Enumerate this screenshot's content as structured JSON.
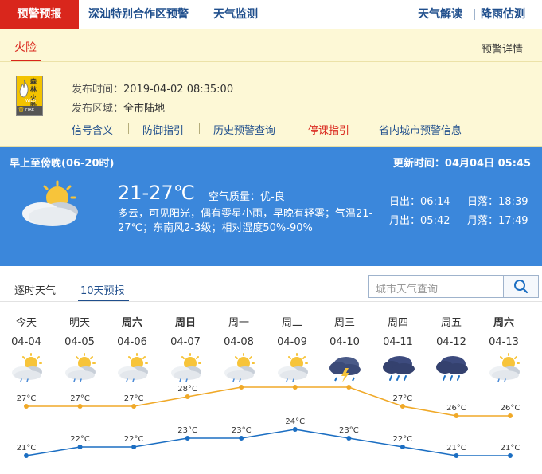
{
  "nav": {
    "active": "预警预报",
    "links": [
      "深汕特别合作区预警",
      "天气监测"
    ],
    "right_links": [
      "天气解读",
      "降雨估测"
    ]
  },
  "warning": {
    "tab": "火险",
    "detail_link": "预警详情",
    "icon": {
      "name": "forest-fire-yellow-icon",
      "text_top": "森林",
      "text_mid": "火险",
      "level": "黄",
      "label": "WILD FIRE"
    },
    "time_label": "发布时间：",
    "time_value": "2019-04-02 08:35:00",
    "area_label": "发布区域：",
    "area_value": "全市陆地",
    "links": [
      "信号含义",
      "防御指引",
      "历史预警查询",
      "停课指引",
      "省内城市预警信息"
    ]
  },
  "forecast": {
    "period": "早上至傍晚(06-20时)",
    "update_label": "更新时间：",
    "update_value": "04月04日 05:45",
    "temp": "21-27℃",
    "aq_label": "空气质量：",
    "aq_value": "优-良",
    "desc": "多云，可见阳光，偶有零星小雨，早晚有轻雾；气温21-27℃；东南风2-3级；相对湿度50%-90%",
    "sunrise_label": "日出：",
    "sunrise": "06:14",
    "sunset_label": "日落：",
    "sunset": "18:39",
    "moonrise_label": "月出：",
    "moonrise": "05:42",
    "moonset_label": "月落：",
    "moonset": "17:49"
  },
  "tabs": [
    "逐时天气",
    "10天预报"
  ],
  "search": {
    "placeholder": "城市天气查询"
  },
  "days": [
    {
      "name": "今天",
      "date": "04-04",
      "bold": false,
      "icon": "partly-cloudy-sun-rain-icon",
      "high": "27°C",
      "low": "21°C"
    },
    {
      "name": "明天",
      "date": "04-05",
      "bold": false,
      "icon": "partly-cloudy-sun-rain-icon",
      "high": "27°C",
      "low": "22°C"
    },
    {
      "name": "周六",
      "date": "04-06",
      "bold": true,
      "icon": "partly-cloudy-sun-rain-icon",
      "high": "27°C",
      "low": "22°C"
    },
    {
      "name": "周日",
      "date": "04-07",
      "bold": true,
      "icon": "partly-cloudy-sun-rain-icon",
      "high": "28°C",
      "low": "23°C"
    },
    {
      "name": "周一",
      "date": "04-08",
      "bold": false,
      "icon": "partly-cloudy-sun-rain-icon",
      "high": "29°C",
      "low": "23°C"
    },
    {
      "name": "周二",
      "date": "04-09",
      "bold": false,
      "icon": "partly-cloudy-sun-rain-icon",
      "high": "29°C",
      "low": "24°C"
    },
    {
      "name": "周三",
      "date": "04-10",
      "bold": false,
      "icon": "thunderstorm-icon",
      "high": "29°C",
      "low": "23°C"
    },
    {
      "name": "周四",
      "date": "04-11",
      "bold": false,
      "icon": "rain-cloud-icon",
      "high": "27°C",
      "low": "22°C"
    },
    {
      "name": "周五",
      "date": "04-12",
      "bold": false,
      "icon": "rain-cloud-icon",
      "high": "26°C",
      "low": "21°C"
    },
    {
      "name": "周六",
      "date": "04-13",
      "bold": true,
      "icon": "partly-cloudy-sun-rain-icon",
      "high": "26°C",
      "low": "21°C"
    }
  ],
  "chart_data": {
    "type": "line",
    "x": [
      "04-04",
      "04-05",
      "04-06",
      "04-07",
      "04-08",
      "04-09",
      "04-10",
      "04-11",
      "04-12",
      "04-13"
    ],
    "series": [
      {
        "values": [
          27,
          27,
          27,
          28,
          29,
          29,
          29,
          27,
          26,
          26
        ],
        "color": "#f0a928"
      },
      {
        "values": [
          21,
          22,
          22,
          23,
          23,
          24,
          23,
          22,
          21,
          21
        ],
        "color": "#1b6ec2"
      }
    ],
    "ylim": [
      20,
      30
    ]
  },
  "colors": {
    "red": "#d9261c",
    "blue": "#3b87db",
    "link": "#1f4e8c",
    "high": "#f0a928",
    "low": "#1b6ec2"
  }
}
